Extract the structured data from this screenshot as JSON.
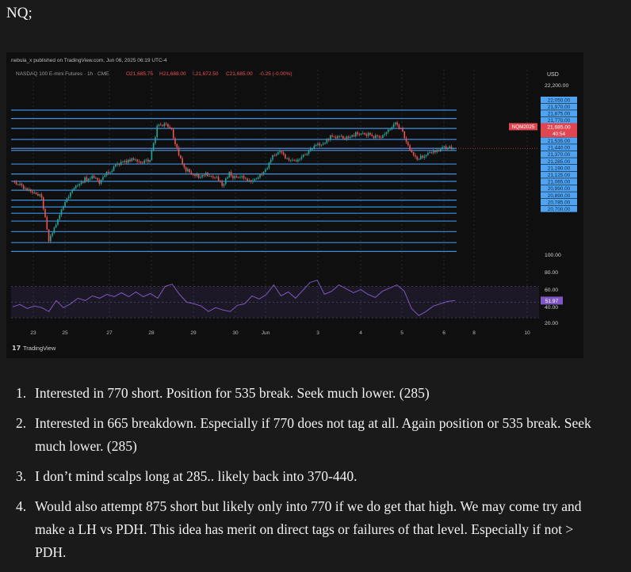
{
  "post": {
    "title": "NQ;"
  },
  "chart_header": {
    "published": "nebula_x published on TradingView.com, Jun 06, 2025 06:19 UTC-4",
    "symbol_line": "NASDAQ 100 E-mini Futures · 1h · CME",
    "ohlc": {
      "o": "O21,685.75",
      "h": "H21,688.00",
      "l": "L21,672.50",
      "c": "C21,685.00",
      "chg": "-0.25 (-0.00%)"
    },
    "currency": "USD",
    "brand": "TradingView"
  },
  "colors": {
    "up": "#26a69a",
    "down": "#ef5350",
    "level": "#3d8fe0",
    "level_label": "#4fa3f0",
    "rsi": "#7e57c2",
    "price_tag": "#e04552"
  },
  "current_price": {
    "symbol": "NQM2025",
    "price": "21,685.00",
    "countdown": "40:54",
    "value": 21685
  },
  "rsi_current": {
    "label": "51.97",
    "value": 51.97
  },
  "chart_data": [
    {
      "type": "candlestick",
      "title": "",
      "symbol": "NASDAQ 100 E-mini Futures · 1h · CME",
      "x_ticks": [
        "23",
        "25",
        "27",
        "28",
        "29",
        "30",
        "Jun",
        "3",
        "4",
        "5",
        "6",
        "8",
        "10"
      ],
      "y_ticks": [
        "22,200.00"
      ],
      "ylim": [
        20650,
        22300
      ],
      "levels": [
        {
          "value": 22050,
          "label": "22,050.00"
        },
        {
          "value": 21970,
          "label": "21,970.00"
        },
        {
          "value": 21875,
          "label": "21,875.00"
        },
        {
          "value": 21770,
          "label": "21,770.00"
        },
        {
          "value": 21685,
          "label": "21,685.00"
        },
        {
          "value": 21665,
          "label": "21,665.00"
        },
        {
          "value": 21535,
          "label": "21,535.00"
        },
        {
          "value": 21440,
          "label": "21,440.00"
        },
        {
          "value": 21370,
          "label": "21,370.00"
        },
        {
          "value": 21285,
          "label": "21,285.00"
        },
        {
          "value": 21190,
          "label": "21,190.00"
        },
        {
          "value": 21125,
          "label": "21,125.00"
        },
        {
          "value": 21065,
          "label": "21,065.00"
        },
        {
          "value": 20990,
          "label": "20,990.00"
        },
        {
          "value": 20890,
          "label": "20,890.00"
        },
        {
          "value": 20785,
          "label": "20,785.00"
        },
        {
          "value": 20700,
          "label": "20,700.00"
        }
      ],
      "price_path": [
        21390,
        21330,
        21300,
        21260,
        21220,
        20800,
        20950,
        21140,
        21270,
        21330,
        21390,
        21410,
        21360,
        21440,
        21500,
        21560,
        21560,
        21580,
        21540,
        21580,
        21890,
        21920,
        21860,
        21620,
        21480,
        21440,
        21410,
        21440,
        21420,
        21330,
        21440,
        21400,
        21410,
        21370,
        21420,
        21480,
        21600,
        21640,
        21590,
        21560,
        21600,
        21650,
        21720,
        21740,
        21800,
        21790,
        21780,
        21810,
        21830,
        21820,
        21790,
        21800,
        21850,
        21930,
        21850,
        21650,
        21580,
        21620,
        21650,
        21670,
        21690,
        21685
      ]
    },
    {
      "type": "line",
      "title": "",
      "name": "",
      "y_ticks": [
        "100.00",
        "80.00",
        "60.00",
        "40.00",
        "20.00"
      ],
      "ylim": [
        20,
        100
      ],
      "bands": [
        30,
        70
      ],
      "values": [
        44,
        47,
        42,
        45,
        43,
        38,
        52,
        43,
        48,
        55,
        52,
        58,
        55,
        60,
        57,
        62,
        57,
        63,
        57,
        61,
        55,
        70,
        73,
        60,
        50,
        48,
        45,
        38,
        43,
        40,
        38,
        46,
        48,
        58,
        54,
        60,
        72,
        58,
        63,
        55,
        65,
        75,
        78,
        60,
        64,
        72,
        67,
        62,
        66,
        60,
        56,
        64,
        68,
        72,
        64,
        42,
        33,
        38,
        45,
        48,
        51,
        51.97
      ]
    }
  ],
  "notes": [
    {
      "num": "1.",
      "text": "Interested in 770 short. Position for 535 break. Seek much lower. (285)"
    },
    {
      "num": "2.",
      "text": "Interested in 665 breakdown. Especially if 770 does not tag at all. Again position or 535 break. Seek much lower. (285)"
    },
    {
      "num": "3.",
      "text": "I don’t mind scalps long at 285.. likely back into 370-440."
    },
    {
      "num": "4.",
      "text": "Would also attempt 875 short but likely only into 770 if we do get that high. We may come try and make a LH vs PDH. This idea has merit on direct tags or failures of that level. Especially if not > PDH."
    }
  ]
}
